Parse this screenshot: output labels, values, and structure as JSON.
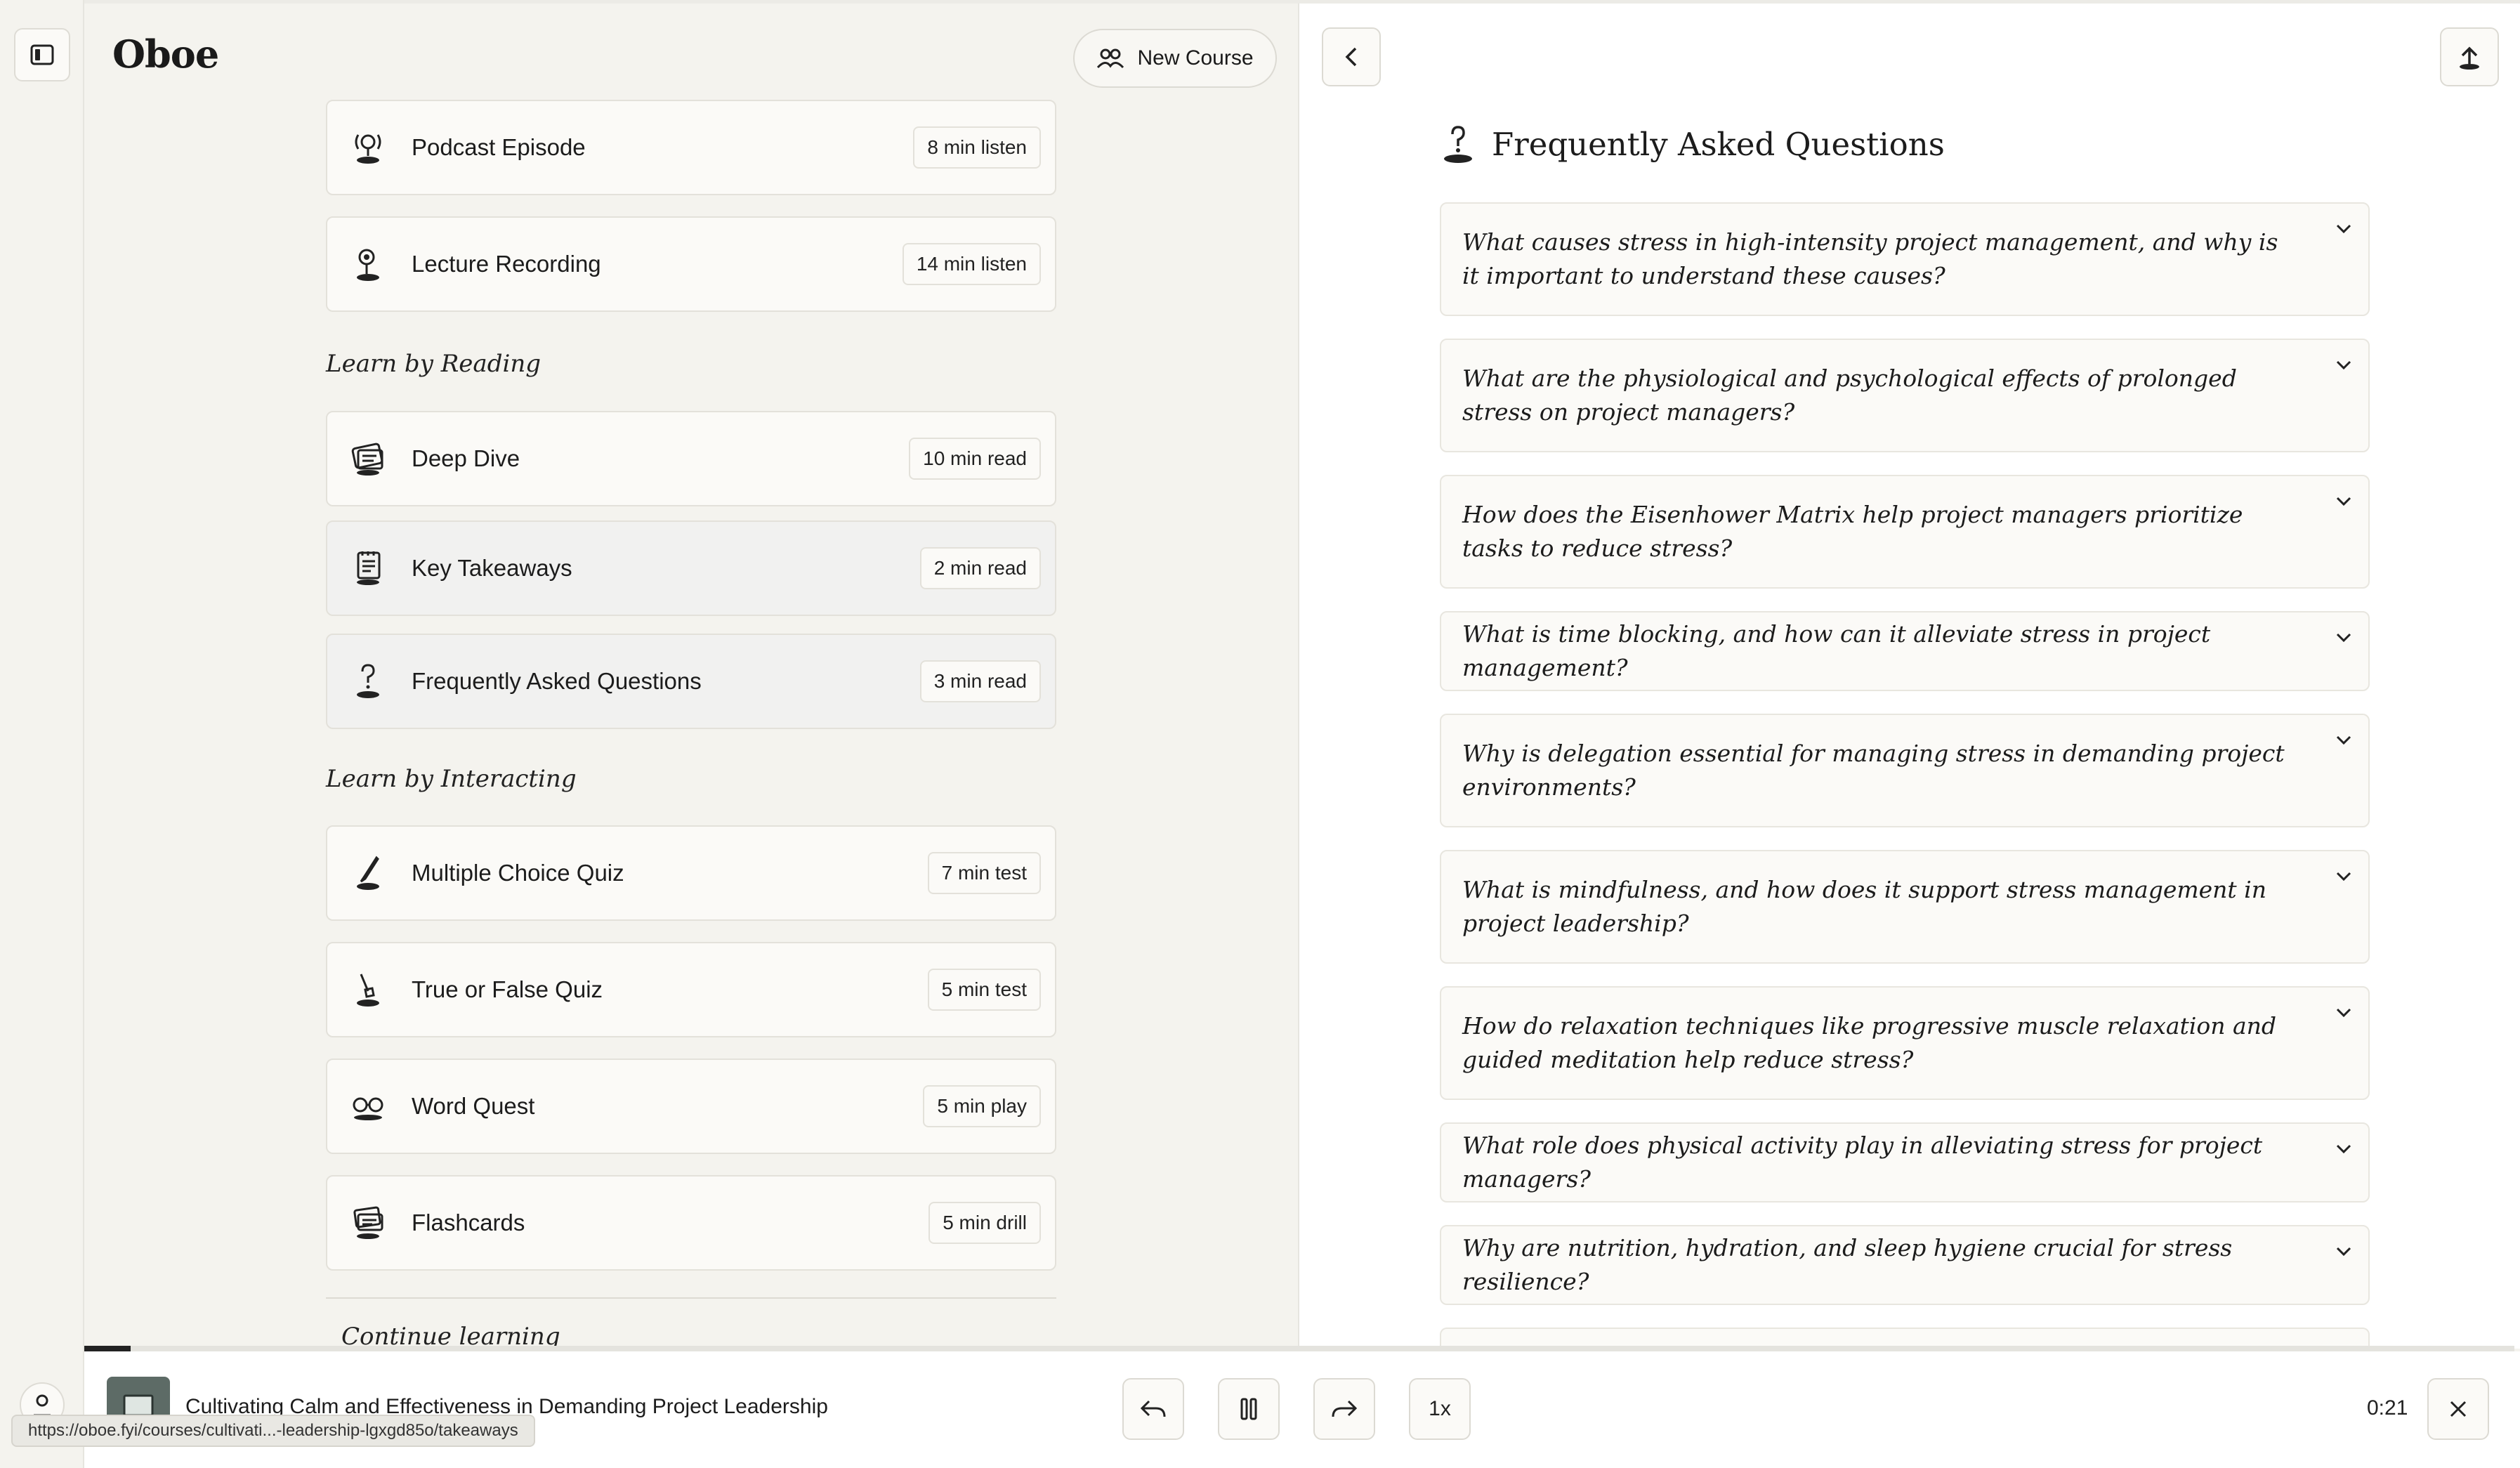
{
  "app": {
    "name": "Oboe",
    "new_course_label": "New Course"
  },
  "sections": {
    "reading_header": "Learn by Reading",
    "interacting_header": "Learn by Interacting",
    "continue_header": "Continue learning"
  },
  "listening_items": [
    {
      "label": "Podcast Episode",
      "meta": "8 min listen",
      "icon": "microphone-icon"
    },
    {
      "label": "Lecture Recording",
      "meta": "14 min listen",
      "icon": "lecture-icon"
    }
  ],
  "reading_items": [
    {
      "label": "Deep Dive",
      "meta": "10 min read",
      "icon": "book-icon"
    },
    {
      "label": "Key Takeaways",
      "meta": "2 min read",
      "icon": "notepad-icon"
    },
    {
      "label": "Frequently Asked Questions",
      "meta": "3 min read",
      "icon": "question-icon"
    }
  ],
  "interacting_items": [
    {
      "label": "Multiple Choice Quiz",
      "meta": "7 min test",
      "icon": "pencil-icon"
    },
    {
      "label": "True or False Quiz",
      "meta": "5 min test",
      "icon": "brush-icon"
    },
    {
      "label": "Word Quest",
      "meta": "5 min play",
      "icon": "glasses-icon"
    },
    {
      "label": "Flashcards",
      "meta": "5 min drill",
      "icon": "cards-icon"
    }
  ],
  "faq": {
    "title": "Frequently Asked Questions",
    "questions": [
      "What causes stress in high-intensity project management, and why is it important to understand these causes?",
      "What are the physiological and psychological effects of prolonged stress on project managers?",
      "How does the Eisenhower Matrix help project managers prioritize tasks to reduce stress?",
      "What is time blocking, and how can it alleviate stress in project management?",
      "Why is delegation essential for managing stress in demanding project environments?",
      "What is mindfulness, and how does it support stress management in project leadership?",
      "How do relaxation techniques like progressive muscle relaxation and guided meditation help reduce stress?",
      "What role does physical activity play in alleviating stress for project managers?",
      "Why are nutrition, hydration, and sleep hygiene crucial for stress resilience?"
    ]
  },
  "player": {
    "title": "Cultivating Calm and Effectiveness in Demanding Project Leadership",
    "speed": "1x",
    "time": "0:21",
    "progress": 0.019
  },
  "status_url": "https://oboe.fyi/courses/cultivati...-leadership-lgxgd85o/takeaways"
}
